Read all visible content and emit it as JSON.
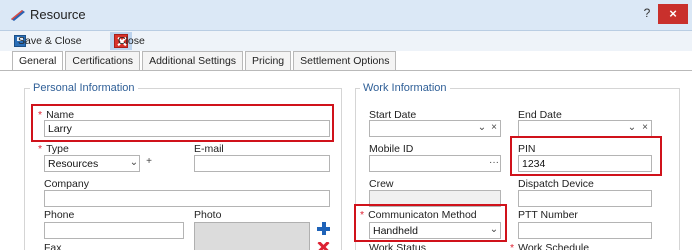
{
  "window": {
    "title": "Resource",
    "help": "?",
    "close": "×"
  },
  "toolbar": {
    "save_close": "Save & Close",
    "close": "Close"
  },
  "tabs": [
    "General",
    "Certifications",
    "Additional Settings",
    "Pricing",
    "Settlement Options"
  ],
  "personal": {
    "title": "Personal Information",
    "name_label": "Name",
    "name_value": "Larry",
    "type_label": "Type",
    "type_value": "Resources",
    "email_label": "E-mail",
    "email_value": "",
    "company_label": "Company",
    "company_value": "",
    "phone_label": "Phone",
    "phone_value": "",
    "photo_label": "Photo",
    "fax_label": "Fax"
  },
  "work": {
    "title": "Work Information",
    "start_date_label": "Start Date",
    "end_date_label": "End Date",
    "mobile_id_label": "Mobile ID",
    "pin_label": "PIN",
    "pin_value": "1234",
    "crew_label": "Crew",
    "dispatch_device_label": "Dispatch Device",
    "comm_method_label": "Communicaton Method",
    "comm_method_value": "Handheld",
    "ptt_label": "PTT Number",
    "work_status_label": "Work Status",
    "work_schedule_label": "Work Schedule"
  },
  "glyphs": {
    "chevron": "⌄",
    "clear": "×",
    "plus": "+",
    "ellipsis": "···",
    "required": "*"
  },
  "colors": {
    "accent": "#2f5f97",
    "highlight": "#d0121b",
    "titlebar": "#dbe8f6"
  }
}
